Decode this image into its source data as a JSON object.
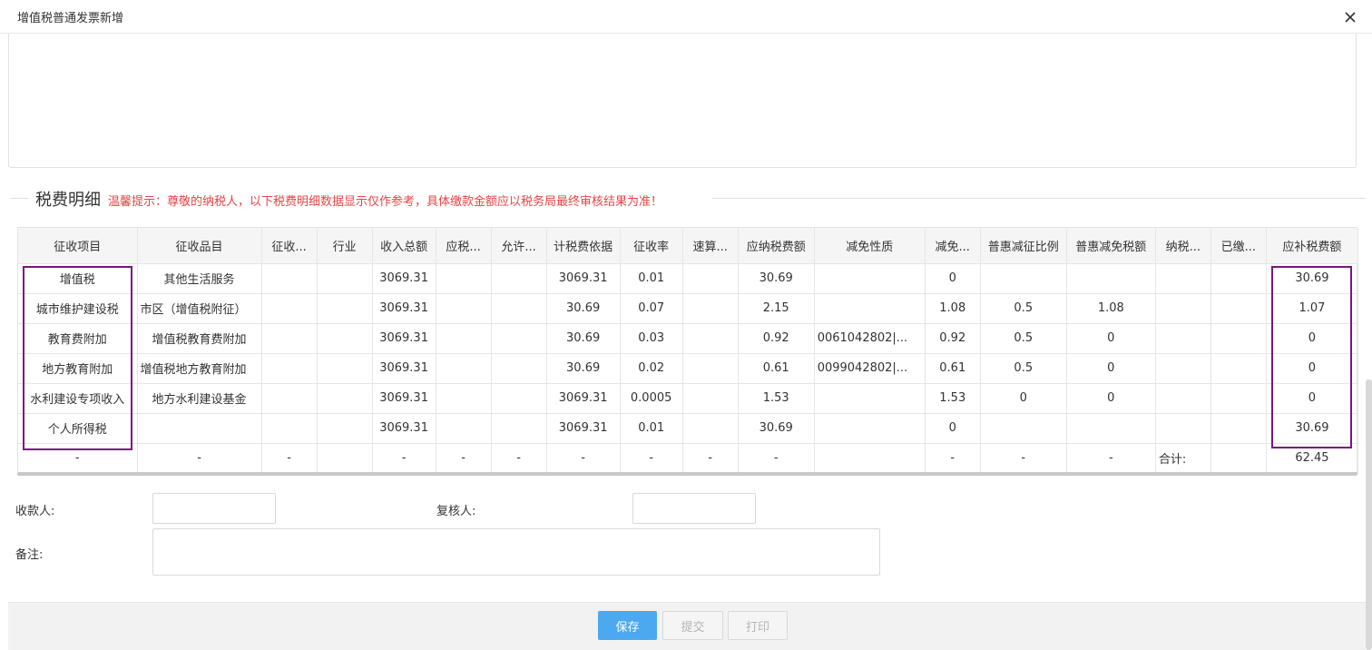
{
  "dialog": {
    "title": "增值税普通发票新增"
  },
  "section": {
    "title": "税费明细",
    "tip": "温馨提示：尊敬的纳税人，以下税费明细数据显示仅作参考，具体缴款金额应以税务局最终审核结果为准！"
  },
  "table": {
    "headers": [
      "征收项目",
      "征收品目",
      "征收...",
      "行业",
      "收入总额",
      "应税...",
      "允许...",
      "计税费依据",
      "征收率",
      "速算...",
      "应纳税费额",
      "减免性质",
      "减免...",
      "普惠减征比例",
      "普惠减免税额",
      "纳税...",
      "已缴...",
      "应补税费额"
    ],
    "rows": [
      [
        "增值税",
        "其他生活服务",
        "",
        "",
        "3069.31",
        "",
        "",
        "3069.31",
        "0.01",
        "",
        "30.69",
        "",
        "0",
        "",
        "",
        "",
        "",
        "30.69"
      ],
      [
        "城市维护建设税",
        "市区（增值税附征）",
        "",
        "",
        "3069.31",
        "",
        "",
        "30.69",
        "0.07",
        "",
        "2.15",
        "",
        "1.08",
        "0.5",
        "1.08",
        "",
        "",
        "1.07"
      ],
      [
        "教育费附加",
        "增值税教育费附加",
        "",
        "",
        "3069.31",
        "",
        "",
        "30.69",
        "0.03",
        "",
        "0.92",
        "0061042802|...",
        "0.92",
        "0.5",
        "0",
        "",
        "",
        "0"
      ],
      [
        "地方教育附加",
        "增值税地方教育附加",
        "",
        "",
        "3069.31",
        "",
        "",
        "30.69",
        "0.02",
        "",
        "0.61",
        "0099042802|...",
        "0.61",
        "0.5",
        "0",
        "",
        "",
        "0"
      ],
      [
        "水利建设专项收入",
        "地方水利建设基金",
        "",
        "",
        "3069.31",
        "",
        "",
        "3069.31",
        "0.0005",
        "",
        "1.53",
        "",
        "1.53",
        "0",
        "0",
        "",
        "",
        "0"
      ],
      [
        "个人所得税",
        "",
        "",
        "",
        "3069.31",
        "",
        "",
        "3069.31",
        "0.01",
        "",
        "30.69",
        "",
        "0",
        "",
        "",
        "",
        "",
        "30.69"
      ]
    ],
    "total_row": [
      "-",
      "-",
      "-",
      "",
      "-",
      "-",
      "-",
      "-",
      "-",
      "-",
      "-",
      "",
      "-",
      "-",
      "-",
      "合计:",
      "",
      "62.45"
    ]
  },
  "form": {
    "payee_label": "收款人:",
    "payee_value": "",
    "reviewer_label": "复核人:",
    "reviewer_value": "",
    "remark_label": "备注:",
    "remark_value": ""
  },
  "buttons": {
    "save": "保存",
    "submit": "提交",
    "print": "打印"
  },
  "colors": {
    "primary": "#4da9ef",
    "tip": "#e64545",
    "highlight": "#7a1680"
  }
}
